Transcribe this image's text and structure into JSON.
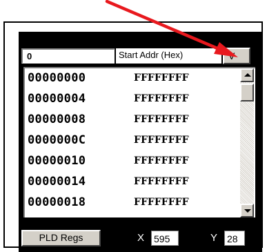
{
  "toolbar": {
    "start_addr_value": "0",
    "start_addr_label": "Start Addr (Hex)",
    "view_button_label": "V"
  },
  "memory": {
    "rows": [
      {
        "addr": "00000000",
        "value": "FFFFFFFF"
      },
      {
        "addr": "00000004",
        "value": "FFFFFFFF"
      },
      {
        "addr": "00000008",
        "value": "FFFFFFFF"
      },
      {
        "addr": "0000000C",
        "value": "FFFFFFFF"
      },
      {
        "addr": "00000010",
        "value": "FFFFFFFF"
      },
      {
        "addr": "00000014",
        "value": "FFFFFFFF"
      },
      {
        "addr": "00000018",
        "value": "FFFFFFFF"
      }
    ]
  },
  "status": {
    "pld_regs_label": "PLD Regs",
    "x_label": "X",
    "x_value": "595",
    "y_label": "Y",
    "y_value": "28"
  },
  "colors": {
    "annotation_arrow": "#e8191e",
    "panel_background": "#000000",
    "button_face": "#d4d0c8"
  },
  "icons": {
    "scroll_up": "triangle-up-icon",
    "scroll_down": "triangle-down-icon"
  }
}
